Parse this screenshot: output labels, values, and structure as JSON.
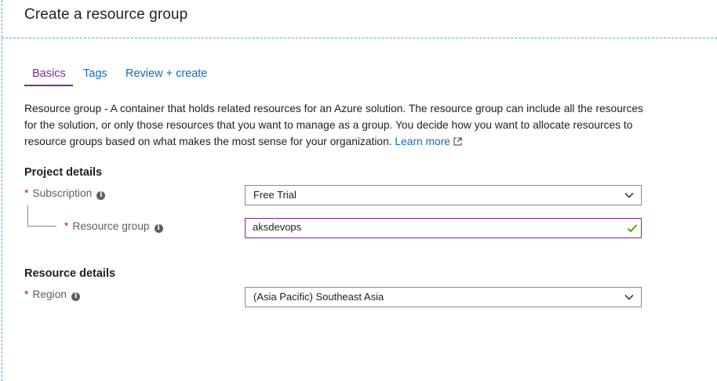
{
  "page": {
    "title": "Create a resource group"
  },
  "tabs": [
    {
      "label": "Basics",
      "active": true
    },
    {
      "label": "Tags",
      "active": false
    },
    {
      "label": "Review + create",
      "active": false
    }
  ],
  "intro": {
    "term": "Resource group",
    "text": " - A container that holds related resources for an Azure solution. The resource group can include all the resources for the solution, or only those resources that you want to manage as a group. You decide how you want to allocate resources to resource groups based on what makes the most sense for your organization. ",
    "learn_more": "Learn more"
  },
  "project_details": {
    "title": "Project details",
    "subscription": {
      "label": "Subscription",
      "value": "Free Trial"
    },
    "resource_group": {
      "label": "Resource group",
      "value": "aksdevops"
    }
  },
  "resource_details": {
    "title": "Resource details",
    "region": {
      "label": "Region",
      "value": "(Asia Pacific) Southeast Asia"
    }
  },
  "colors": {
    "accent_purple": "#7a2a93",
    "link_blue": "#0f6cbd",
    "required_red": "#c50f1f",
    "valid_green": "#57a300"
  },
  "required_marker": "*",
  "info_glyph": "i"
}
